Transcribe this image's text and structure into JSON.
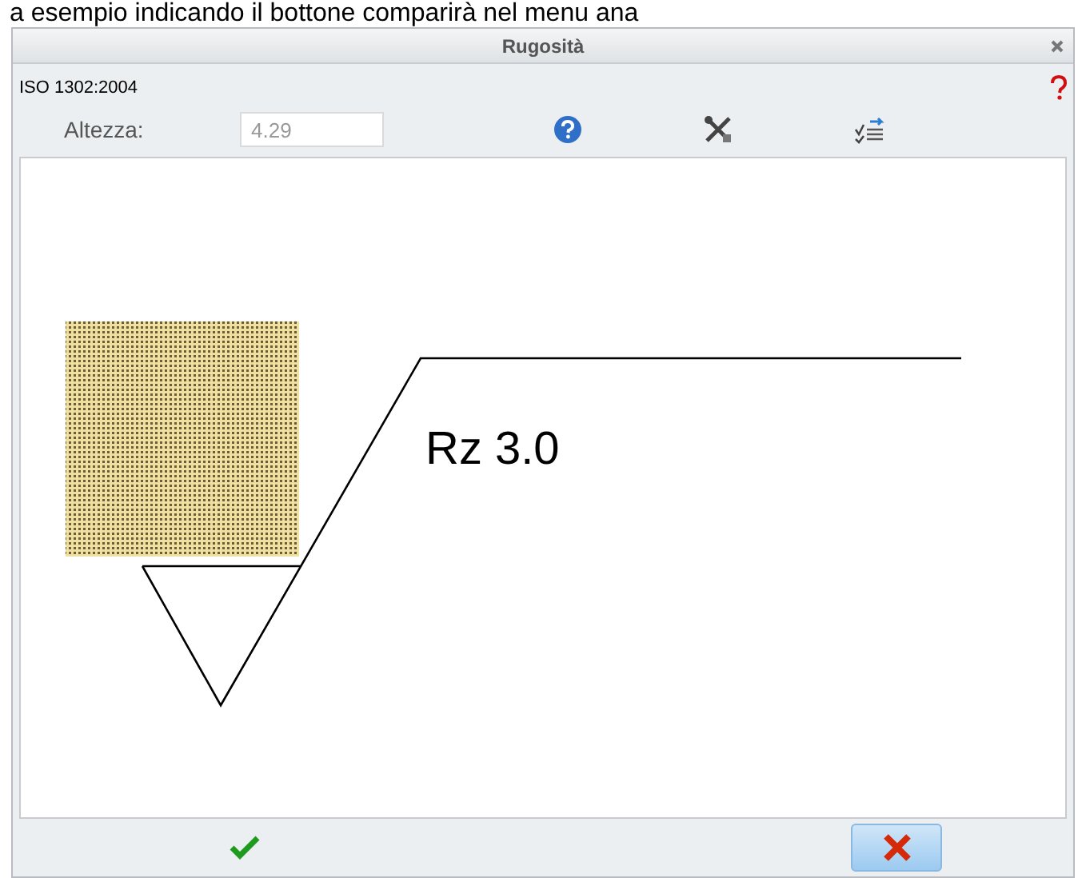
{
  "caption": "a esempio indicando il bottone comparirà nel menu ana",
  "window": {
    "title": "Rugosità"
  },
  "standard": "ISO 1302:2004",
  "height_field": {
    "label": "Altezza:",
    "value": "4.29"
  },
  "symbol": {
    "text": "Rz 3.0"
  }
}
